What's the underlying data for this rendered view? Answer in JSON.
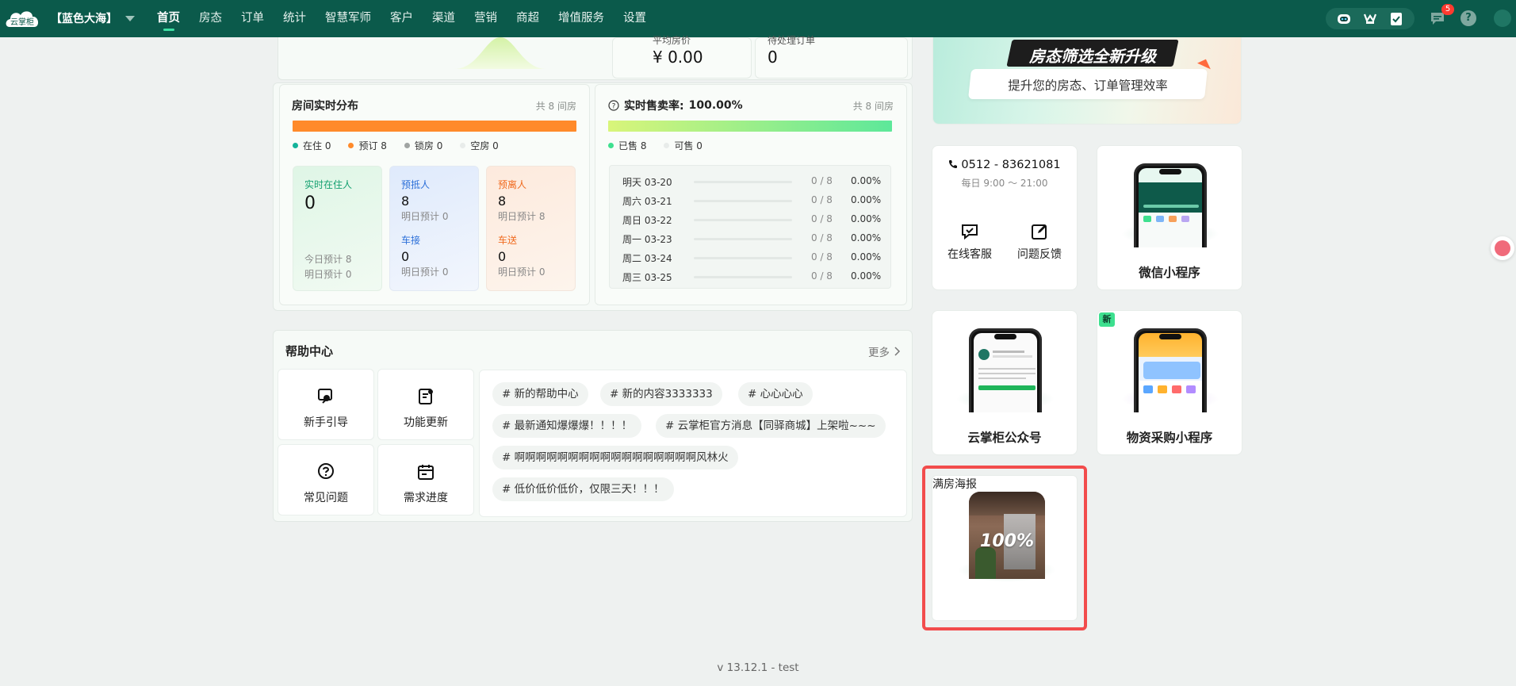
{
  "app": {
    "logo_text": "云掌柜",
    "hotel_name": "【蓝色大海】",
    "nav": [
      "首页",
      "房态",
      "订单",
      "统计",
      "智慧军师",
      "客户",
      "渠道",
      "营销",
      "商超",
      "增值服务",
      "设置"
    ],
    "active_nav": "首页",
    "message_count": "5",
    "help_mark": "?"
  },
  "top_stats": {
    "avg_price_label": "平均房价",
    "avg_price_value": "¥ 0.00",
    "pending_label": "待处理订单",
    "pending_value": "0"
  },
  "room_dist": {
    "title": "房间实时分布",
    "total": "共 8 间房",
    "legend": [
      {
        "label": "在住 0",
        "color": "#14b39a"
      },
      {
        "label": "预订 8",
        "color": "#ff8a2a"
      },
      {
        "label": "锁房 0",
        "color": "#a0a4a2"
      },
      {
        "label": "空房 0",
        "color": "#e8ecea"
      }
    ],
    "cards": {
      "in_house": {
        "title": "实时在住人",
        "value": "0",
        "today": "今日预计 8",
        "tomorrow": "明日预计 0"
      },
      "arrival": {
        "title": "预抵人",
        "value": "8",
        "tomorrow": "明日预计 0"
      },
      "pickup": {
        "title": "车接",
        "value": "0",
        "tomorrow": "明日预计 0"
      },
      "departure": {
        "title": "预离人",
        "value": "8",
        "tomorrow": "明日预计 8"
      },
      "dropoff": {
        "title": "车送",
        "value": "0",
        "tomorrow": "明日预计 0"
      }
    }
  },
  "sales": {
    "title": "实时售卖率:",
    "rate": "100.00%",
    "total": "共 8 间房",
    "legend": [
      {
        "label": "已售 8",
        "color": "#3ee08f"
      },
      {
        "label": "可售 0",
        "color": "#e8ecea"
      }
    ],
    "rows": [
      {
        "day": "明天 03-20",
        "count": "0 / 8",
        "pct": "0.00%"
      },
      {
        "day": "周六 03-21",
        "count": "0 / 8",
        "pct": "0.00%"
      },
      {
        "day": "周日 03-22",
        "count": "0 / 8",
        "pct": "0.00%"
      },
      {
        "day": "周一 03-23",
        "count": "0 / 8",
        "pct": "0.00%"
      },
      {
        "day": "周二 03-24",
        "count": "0 / 8",
        "pct": "0.00%"
      },
      {
        "day": "周三 03-25",
        "count": "0 / 8",
        "pct": "0.00%"
      }
    ]
  },
  "help": {
    "title": "帮助中心",
    "more": "更多",
    "tiles": [
      "新手引导",
      "功能更新",
      "常见问题",
      "需求进度"
    ],
    "tags": [
      "# 新的帮助中心",
      "# 新的内容3333333",
      "# 心心心心",
      "# 最新通知爆爆爆！！！！",
      "# 云掌柜官方消息【同驿商城】上架啦~~~",
      "# 啊啊啊啊啊啊啊啊啊啊啊啊啊啊啊啊啊风林火",
      "# 低价低价低价，仅限三天！！！"
    ]
  },
  "banner": {
    "headline": "房态筛选全新升级",
    "sub": "提升您的房态、订单管理效率"
  },
  "contact": {
    "phone": "0512 - 83621081",
    "hours": "每日 9:00 ～ 21:00",
    "online": "在线客服",
    "feedback": "问题反馈"
  },
  "cards": {
    "wechat_mini": "微信小程序",
    "official": "云掌柜公众号",
    "purchase": "物资采购小程序",
    "new_tag": "新",
    "poster": "满房海报",
    "poster_pct": "100%"
  },
  "footer": {
    "version": "v 13.12.1 - test"
  },
  "colors": {
    "nav_bg": "#0b5a4b",
    "orange": "#ff8a2a",
    "green_accent": "#3ee0a4",
    "highlight_red": "#f24c4c"
  }
}
